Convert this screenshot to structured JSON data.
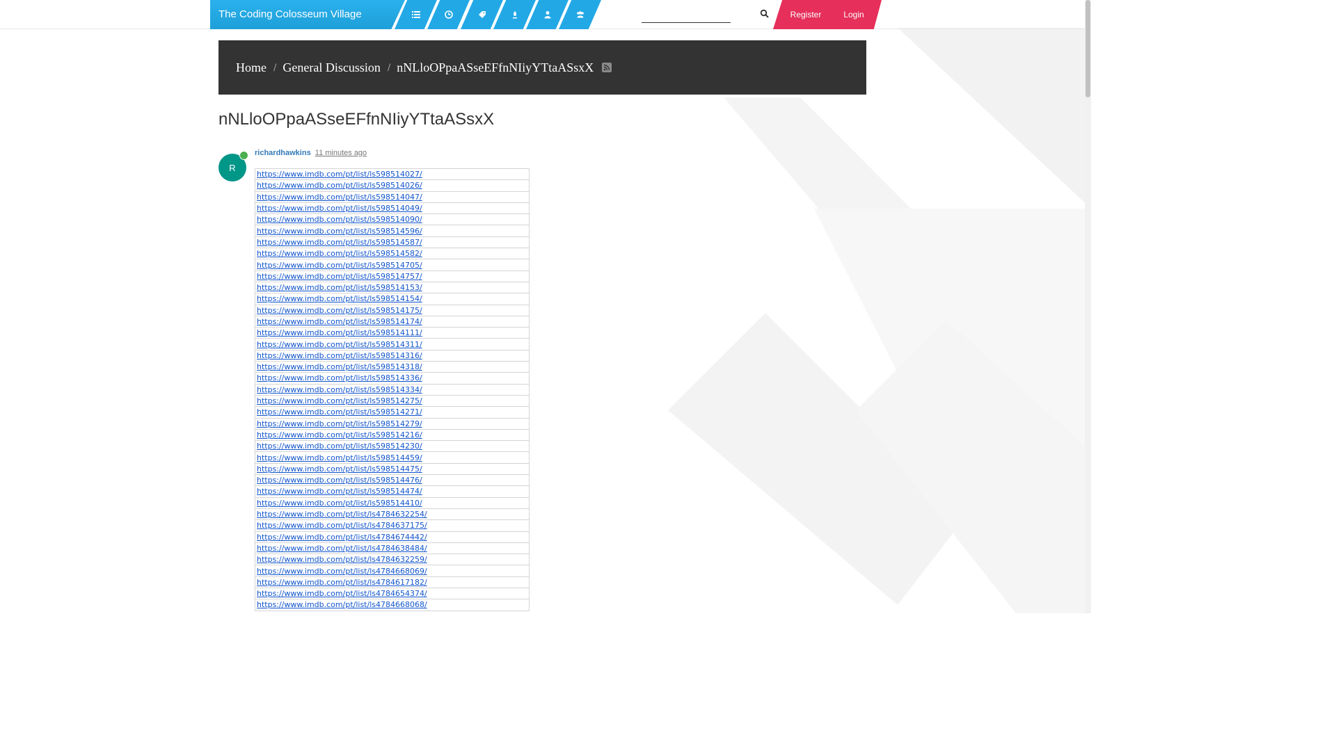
{
  "header": {
    "brand": "The Coding Colosseum Village",
    "nav": [
      {
        "icon": "categories-icon"
      },
      {
        "icon": "recent-icon"
      },
      {
        "icon": "tags-icon"
      },
      {
        "icon": "popular-icon"
      },
      {
        "icon": "users-icon"
      },
      {
        "icon": "groups-icon"
      }
    ],
    "search": {
      "placeholder": "",
      "icon": "search-icon"
    },
    "register_label": "Register",
    "login_label": "Login",
    "colors": {
      "nav_blue": "#23a8e6",
      "auth_red": "#e62f5a"
    }
  },
  "breadcrumb": {
    "items": [
      "Home",
      "General Discussion",
      "nNLloOPpaASseEFfnNIiyYTtaASsxX"
    ],
    "rss_icon": "rss-icon"
  },
  "topic": {
    "title": "nNLloOPpaASseEFfnNIiyYTtaASsxX"
  },
  "post": {
    "avatar_letter": "R",
    "author": "richardhawkins",
    "time": "11 minutes ago",
    "links": [
      "https://www.imdb.com/pt/list/ls598514027/",
      "https://www.imdb.com/pt/list/ls598514026/",
      "https://www.imdb.com/pt/list/ls598514047/",
      "https://www.imdb.com/pt/list/ls598514049/",
      "https://www.imdb.com/pt/list/ls598514090/",
      "https://www.imdb.com/pt/list/ls598514596/",
      "https://www.imdb.com/pt/list/ls598514587/",
      "https://www.imdb.com/pt/list/ls598514582/",
      "https://www.imdb.com/pt/list/ls598514705/",
      "https://www.imdb.com/pt/list/ls598514757/",
      "https://www.imdb.com/pt/list/ls598514153/",
      "https://www.imdb.com/pt/list/ls598514154/",
      "https://www.imdb.com/pt/list/ls598514175/",
      "https://www.imdb.com/pt/list/ls598514174/",
      "https://www.imdb.com/pt/list/ls598514111/",
      "https://www.imdb.com/pt/list/ls598514311/",
      "https://www.imdb.com/pt/list/ls598514316/",
      "https://www.imdb.com/pt/list/ls598514318/",
      "https://www.imdb.com/pt/list/ls598514336/",
      "https://www.imdb.com/pt/list/ls598514334/",
      "https://www.imdb.com/pt/list/ls598514275/",
      "https://www.imdb.com/pt/list/ls598514271/",
      "https://www.imdb.com/pt/list/ls598514279/",
      "https://www.imdb.com/pt/list/ls598514216/",
      "https://www.imdb.com/pt/list/ls598514230/",
      "https://www.imdb.com/pt/list/ls598514459/",
      "https://www.imdb.com/pt/list/ls598514475/",
      "https://www.imdb.com/pt/list/ls598514476/",
      "https://www.imdb.com/pt/list/ls598514474/",
      "https://www.imdb.com/pt/list/ls598514410/",
      "https://www.imdb.com/pt/list/ls4784632254/",
      "https://www.imdb.com/pt/list/ls4784637175/",
      "https://www.imdb.com/pt/list/ls4784674442/",
      "https://www.imdb.com/pt/list/ls4784638484/",
      "https://www.imdb.com/pt/list/ls4784632259/",
      "https://www.imdb.com/pt/list/ls4784668069/",
      "https://www.imdb.com/pt/list/ls4784617182/",
      "https://www.imdb.com/pt/list/ls4784654374/",
      "https://www.imdb.com/pt/list/ls4784668068/"
    ]
  }
}
